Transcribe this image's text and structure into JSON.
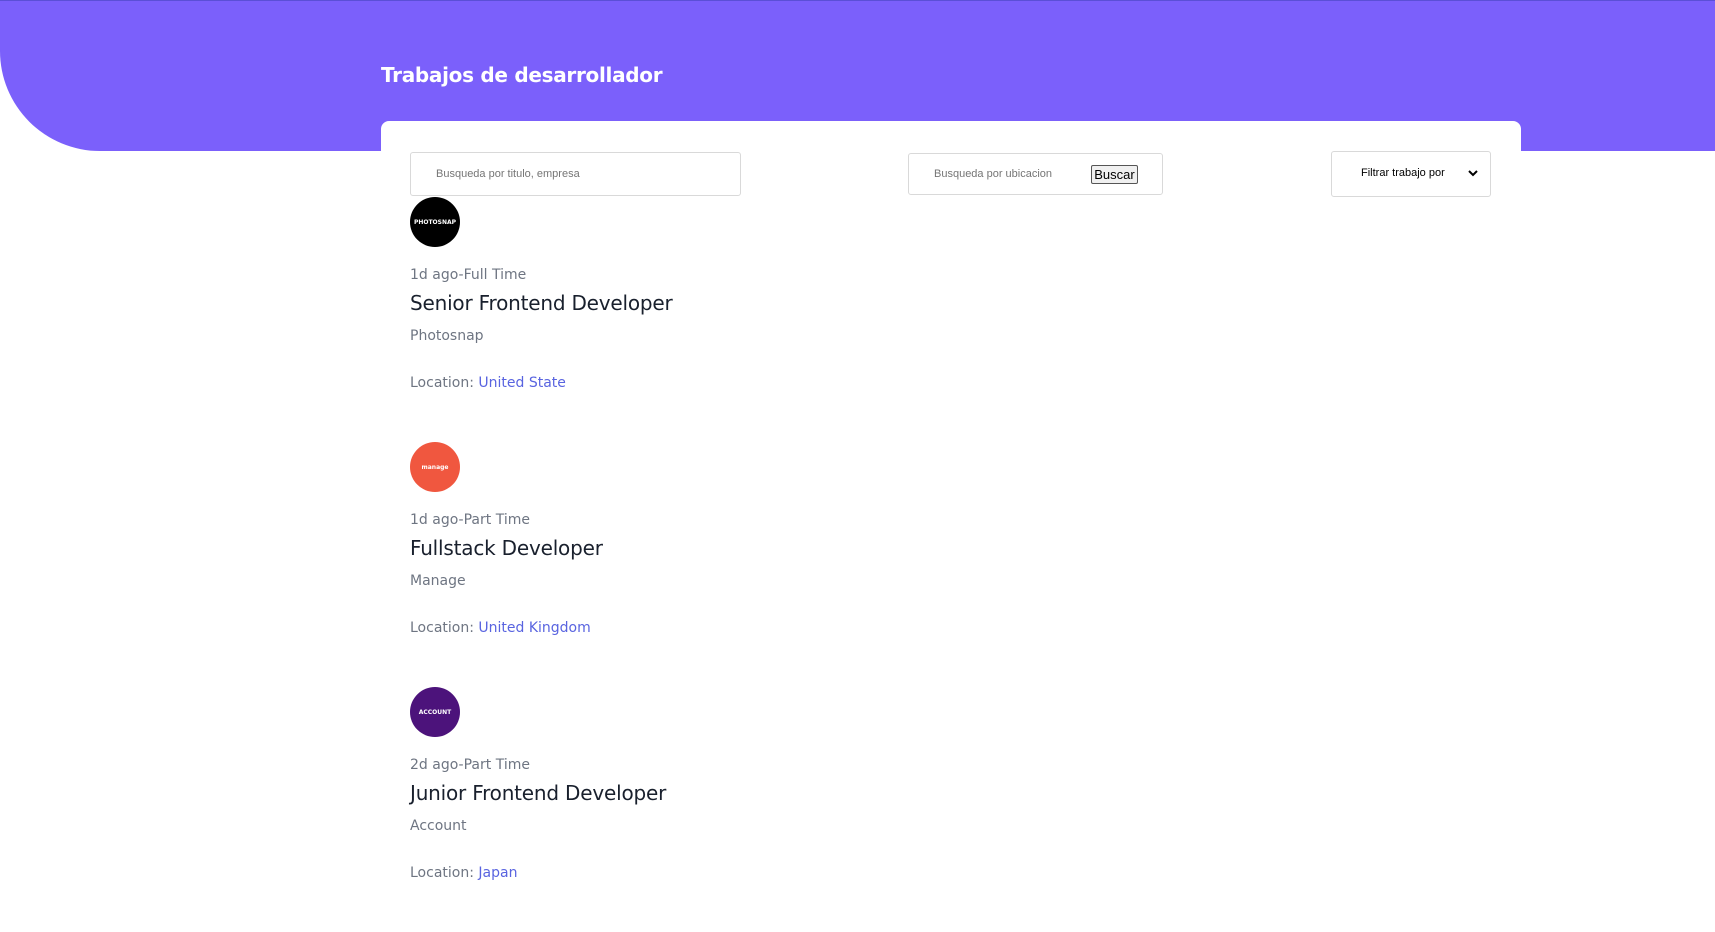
{
  "header": {
    "title": "Trabajos de desarrollador",
    "background_color": "#7b60fb"
  },
  "search": {
    "title_placeholder": "Busqueda por titulo, empresa",
    "location_placeholder": "Busqueda por ubicacion",
    "search_button_label": "Buscar",
    "filter_label": "Filtrar trabajo por"
  },
  "jobs": [
    {
      "logo_text": "PHOTOSNAP",
      "logo_color": "#000000",
      "posted": "1d ago",
      "type": "Full Time",
      "title": "Senior Frontend Developer",
      "company": "Photosnap",
      "location_label": "Location:",
      "location": "United State"
    },
    {
      "logo_text": "manage",
      "logo_color": "#f0573f",
      "posted": "1d ago",
      "type": "Part Time",
      "title": "Fullstack Developer",
      "company": "Manage",
      "location_label": "Location:",
      "location": "United Kingdom"
    },
    {
      "logo_text": "ACCOUNT",
      "logo_color": "#4c137b",
      "posted": "2d ago",
      "type": "Part Time",
      "title": "Junior Frontend Developer",
      "company": "Account",
      "location_label": "Location:",
      "location": "Japan"
    }
  ]
}
